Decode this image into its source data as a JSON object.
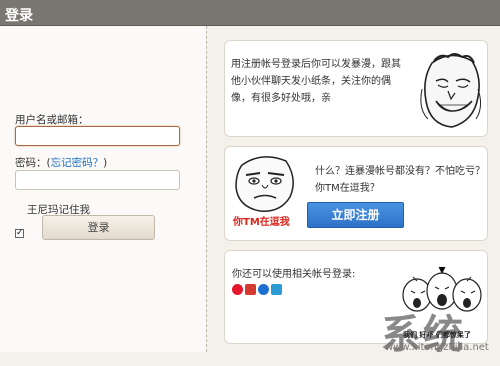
{
  "window": {
    "title": "登录"
  },
  "login": {
    "username_label": "用户名或邮箱：",
    "username_value": "",
    "password_label": "密码：",
    "forgot_password_link": "忘记密码？",
    "password_close": ")",
    "password_open": "(",
    "password_value": "",
    "remember_label": "王尼玛记住我",
    "remember_checked": true,
    "login_button": "登录"
  },
  "cards": {
    "intro_text": [
      "用注册帐号登录后你可以发暴漫，跟其",
      "他小伙伴聊天发小纸条，关注你的偶",
      "像，有很多好处哦，亲"
    ],
    "register_text": [
      "什么？连暴漫帐号都没有？不怕吃亏？",
      "你TM在逗我？"
    ],
    "register_button": "立即注册",
    "meme_caption": "你TM在逗我",
    "social_text": "你还可以使用相关帐号登录:",
    "social_icons": [
      "weibo-icon",
      "renren-icon",
      "qq-icon",
      "tencent-weibo-icon"
    ],
    "crying_caption": "我们 好吓 们都惊呆了"
  },
  "watermark": {
    "logo": "系统",
    "url": "www.xitongzhijia.net"
  },
  "colors": {
    "titlebar": "#7a7670",
    "link": "#1a6fc7",
    "register_button": "#2d72c8",
    "meme_caption": "#d9261c"
  }
}
